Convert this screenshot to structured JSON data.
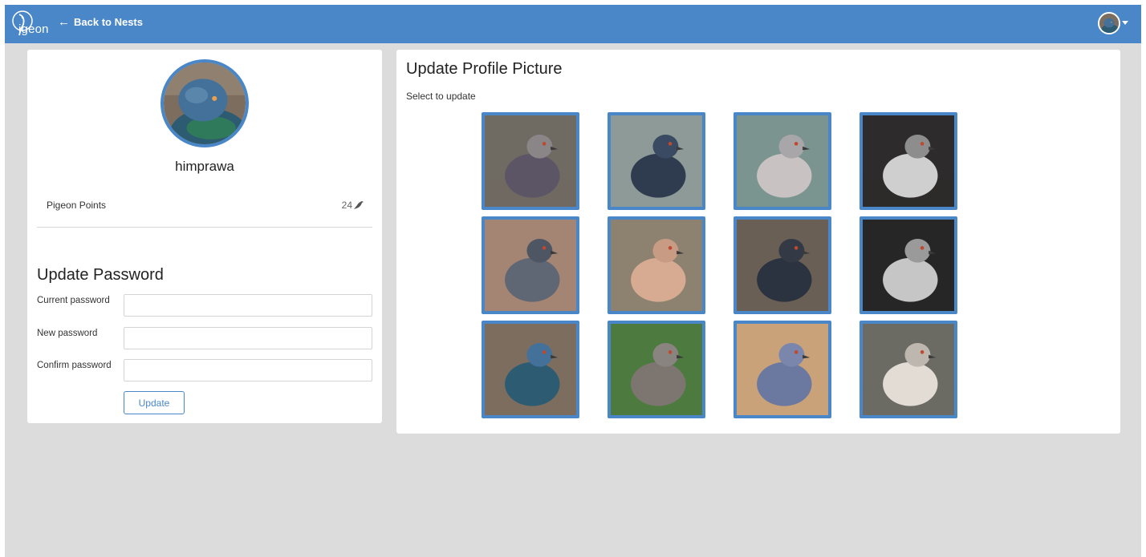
{
  "navbar": {
    "logo_text": "igeon",
    "back_label": "Back to Nests",
    "back_icon": "arrow-left-icon",
    "colors": {
      "bar": "#4a87c8",
      "text": "#ffffff"
    }
  },
  "profile": {
    "username": "himprawa",
    "points_label": "Pigeon Points",
    "points_value": "24",
    "points_icon": "pigeon-icon"
  },
  "password_form": {
    "title": "Update Password",
    "current_label": "Current password",
    "new_label": "New password",
    "confirm_label": "Confirm password",
    "current_value": "",
    "new_value": "",
    "confirm_value": "",
    "update_label": "Update"
  },
  "profile_picture": {
    "title": "Update Profile Picture",
    "subtitle": "Select to update",
    "options": [
      {
        "name": "rock-pigeon-closeup",
        "bg": "#6f6a62",
        "body": "#5c5566",
        "head": "#8a8688"
      },
      {
        "name": "blue-pigeon-standing",
        "bg": "#8d9a98",
        "body": "#2f3c50",
        "head": "#394a62"
      },
      {
        "name": "grey-pigeon-portrait",
        "bg": "#7b9490",
        "body": "#c9c2c3",
        "head": "#a8a6a8"
      },
      {
        "name": "checkered-pigeon-dark",
        "bg": "#2d2b2b",
        "body": "#cfcfcf",
        "head": "#8d8d8d"
      },
      {
        "name": "pigeon-autumn",
        "bg": "#a48472",
        "body": "#5f6674",
        "head": "#4f5663"
      },
      {
        "name": "dove-in-cage",
        "bg": "#8d8270",
        "body": "#d7ab91",
        "head": "#c89c84"
      },
      {
        "name": "dark-pigeon-ground",
        "bg": "#6a5f55",
        "body": "#2b3340",
        "head": "#333a46"
      },
      {
        "name": "white-dark-pigeon",
        "bg": "#262626",
        "body": "#c6c6c6",
        "head": "#9a9a9a"
      },
      {
        "name": "blue-pigeon-head",
        "bg": "#7c6d5e",
        "body": "#2d5c72",
        "head": "#44719a"
      },
      {
        "name": "dove-on-branch",
        "bg": "#4d7a3e",
        "body": "#7d7670",
        "head": "#8a8480"
      },
      {
        "name": "pigeon-couple",
        "bg": "#c9a27a",
        "body": "#6b78a0",
        "head": "#7a86ac"
      },
      {
        "name": "griffon-vulture",
        "bg": "#6b6b64",
        "body": "#e2dcd4",
        "head": "#bdb7af"
      }
    ]
  }
}
